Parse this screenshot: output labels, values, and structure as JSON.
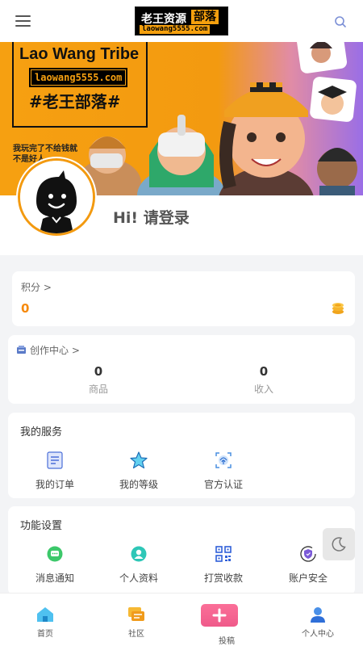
{
  "header": {
    "logo_line1": "老王资源",
    "logo_line2": "部落",
    "logo_url": "laowang5555.com"
  },
  "banner": {
    "title": "Lao Wang Tribe",
    "url": "laowang5555.com",
    "tag": "#老王部落#",
    "small_text": "我玩完了不给钱就不是好人"
  },
  "profile": {
    "login_text": "Hi!  请登录"
  },
  "points": {
    "label": "积分 >",
    "value": "0"
  },
  "creation": {
    "title": "创作中心 >",
    "stats": [
      {
        "value": "0",
        "label": "商品"
      },
      {
        "value": "0",
        "label": "收入"
      }
    ]
  },
  "services": {
    "title": "我的服务",
    "items": [
      {
        "label": "我的订单",
        "icon": "order-icon"
      },
      {
        "label": "我的等级",
        "icon": "star-icon"
      },
      {
        "label": "官方认证",
        "icon": "fingerprint-icon"
      }
    ]
  },
  "settings": {
    "title": "功能设置",
    "items": [
      {
        "label": "消息通知",
        "icon": "message-icon"
      },
      {
        "label": "个人资料",
        "icon": "profile-icon"
      },
      {
        "label": "打赏收款",
        "icon": "qrcode-icon"
      },
      {
        "label": "账户安全",
        "icon": "shield-icon"
      }
    ]
  },
  "tabbar": {
    "items": [
      {
        "label": "首页",
        "icon": "home-icon"
      },
      {
        "label": "社区",
        "icon": "community-icon"
      },
      {
        "label": "投稿",
        "icon": "post-icon"
      },
      {
        "label": "个人中心",
        "icon": "user-icon"
      }
    ]
  },
  "colors": {
    "accent": "#f39a10",
    "points_value": "#f68a0e",
    "post_button": "#ef5a8a"
  }
}
